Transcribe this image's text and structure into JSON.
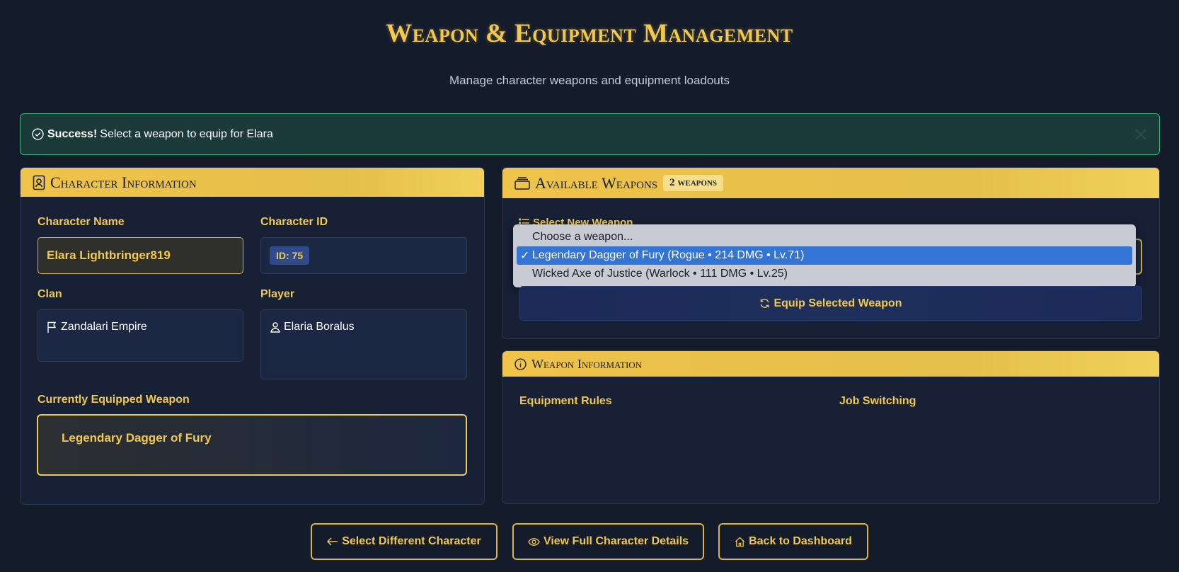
{
  "header": {
    "title": "Weapon & Equipment Management",
    "subtitle": "Manage character weapons and equipment loadouts"
  },
  "alert": {
    "strong": "Success!",
    "message": "Select a weapon to equip for Elara"
  },
  "character": {
    "header": "Character Information",
    "name_label": "Character Name",
    "name_value": "Elara Lightbringer819",
    "id_label": "Character ID",
    "id_value": "ID: 75",
    "clan_label": "Clan",
    "clan_value": "Zandalari Empire",
    "player_label": "Player",
    "player_value": "Elaria Boralus",
    "equipped_label": "Currently Equipped Weapon",
    "equipped_name": "Legendary Dagger of Fury"
  },
  "weapons": {
    "header": "Available Weapons",
    "count_badge": "2 weapons",
    "select_label": "Select New Weapon",
    "options": [
      "Choose a weapon...",
      "Legendary Dagger of Fury (Rogue • 214 DMG • Lv.71)",
      "Wicked Axe of Justice (Warlock • 111 DMG • Lv.25)"
    ],
    "selected_check": "✓",
    "equip_button": "Equip Selected Weapon"
  },
  "info": {
    "header": "Weapon Information",
    "rules_title": "Equipment Rules",
    "switch_title": "Job Switching"
  },
  "buttons": {
    "select_char": "Select Different Character",
    "view_details": "View Full Character Details",
    "dashboard": "Back to Dashboard"
  },
  "colors": {
    "background": "#141b2b",
    "accent_gold": "#f2c94c",
    "success_border": "#39b27a",
    "selected_option": "#3474d4"
  }
}
